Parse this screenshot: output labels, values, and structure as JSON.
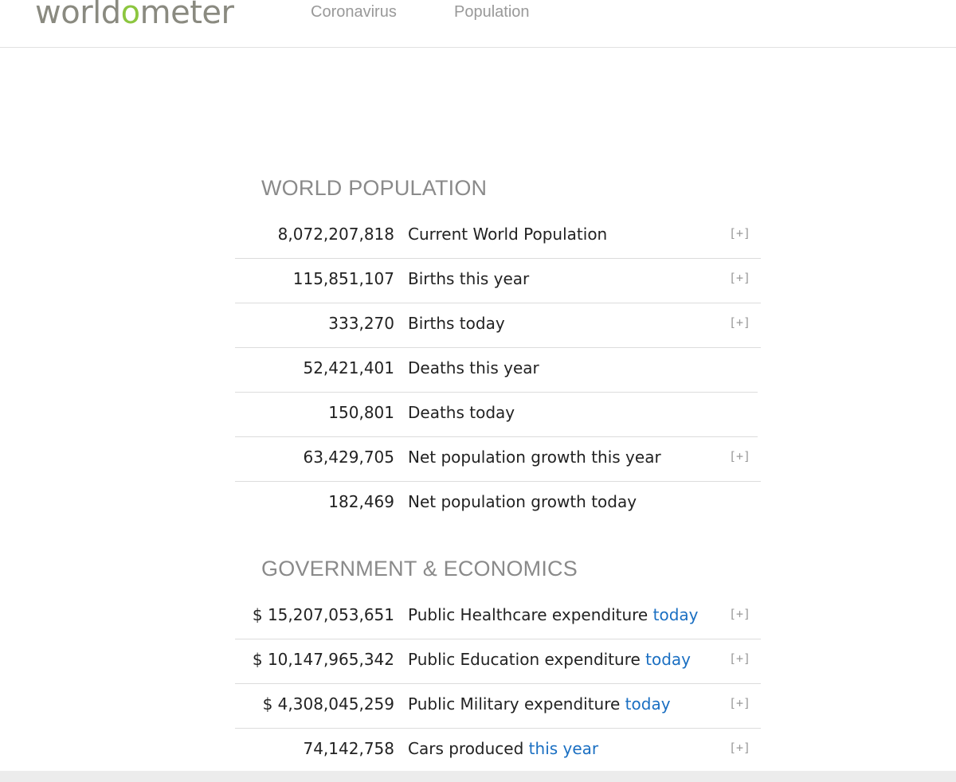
{
  "header": {
    "logo": {
      "part1": "world",
      "part2": "o",
      "part3": "meter"
    },
    "nav": [
      "Coronavirus",
      "Population"
    ]
  },
  "sections": [
    {
      "title": "WORLD POPULATION",
      "rows": [
        {
          "value": "8,072,207,818",
          "label": "Current World Population",
          "link": "",
          "expand": "[+]"
        },
        {
          "value": "115,851,107",
          "label": "Births this year",
          "link": "",
          "expand": "[+]"
        },
        {
          "value": "333,270",
          "label": "Births today",
          "link": "",
          "expand": "[+]"
        },
        {
          "value": "52,421,401",
          "label": "Deaths this year",
          "link": "",
          "expand": ""
        },
        {
          "value": "150,801",
          "label": "Deaths today",
          "link": "",
          "expand": ""
        },
        {
          "value": "63,429,705",
          "label": "Net population growth this year",
          "link": "",
          "expand": "[+]"
        },
        {
          "value": "182,469",
          "label": "Net population growth today",
          "link": "",
          "expand": ""
        }
      ]
    },
    {
      "title": "GOVERNMENT & ECONOMICS",
      "rows": [
        {
          "value": "$ 15,207,053,651",
          "label": "Public Healthcare expenditure ",
          "link": "today",
          "expand": "[+]"
        },
        {
          "value": "$ 10,147,965,342",
          "label": "Public Education expenditure ",
          "link": "today",
          "expand": "[+]"
        },
        {
          "value": "$ 4,308,045,259",
          "label": "Public Military expenditure ",
          "link": "today",
          "expand": "[+]"
        },
        {
          "value": "74,142,758",
          "label": "Cars produced ",
          "link": "this year",
          "expand": "[+]"
        }
      ]
    }
  ],
  "colors": {
    "link": "#1a6fc2",
    "logo_gray": "#8a8a80",
    "logo_green": "#8cc63f"
  }
}
